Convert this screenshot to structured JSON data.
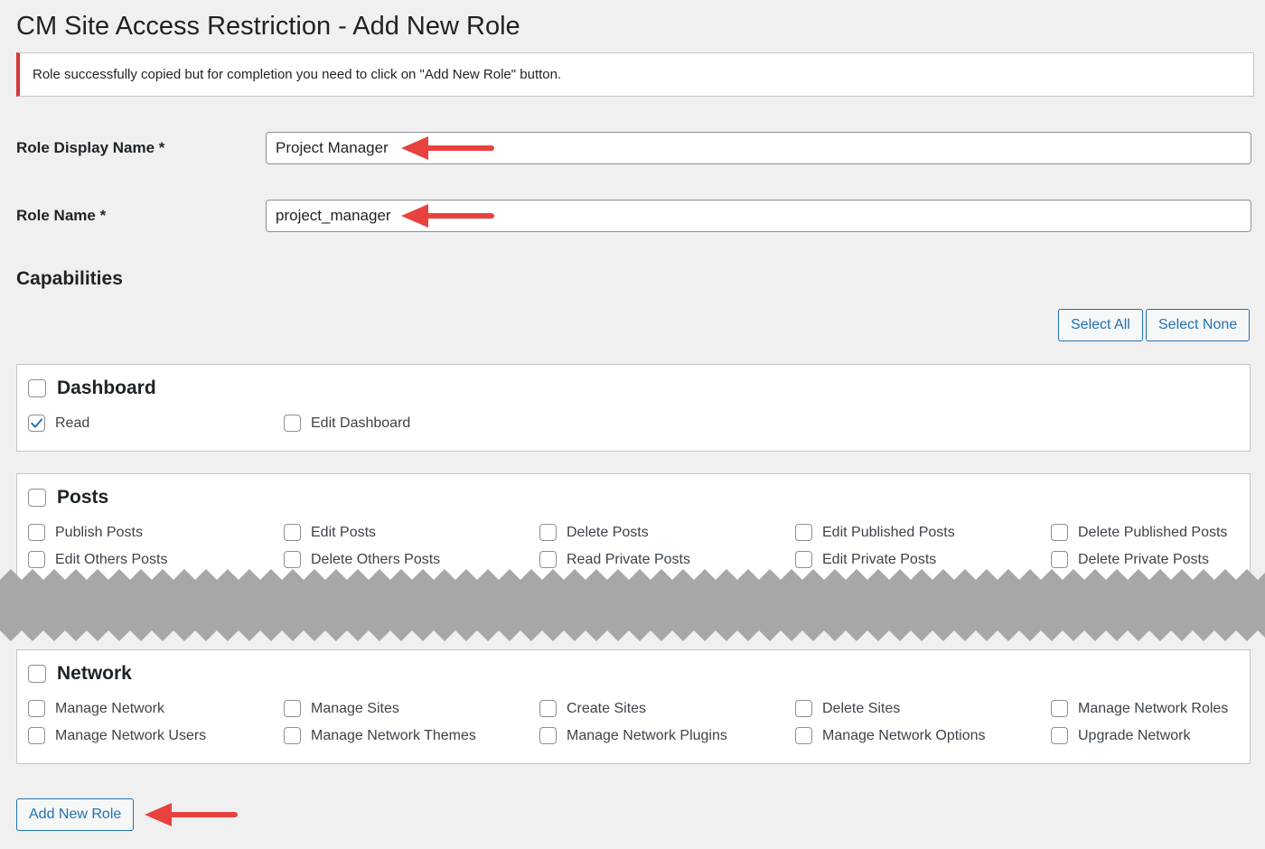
{
  "page_title": "CM Site Access Restriction - Add New Role",
  "notice_text": "Role successfully copied but for completion you need to click on \"Add New Role\" button.",
  "form": {
    "display_name_label": "Role Display Name *",
    "display_name_value": "Project Manager",
    "role_name_label": "Role Name *",
    "role_name_value": "project_manager"
  },
  "capabilities_title": "Capabilities",
  "select_all_label": "Select All",
  "select_none_label": "Select None",
  "groups": {
    "dashboard": {
      "title": "Dashboard",
      "checked": false,
      "items": [
        {
          "label": "Read",
          "checked": true
        },
        {
          "label": "Edit Dashboard",
          "checked": false
        }
      ]
    },
    "posts": {
      "title": "Posts",
      "checked": false,
      "items": [
        {
          "label": "Publish Posts",
          "checked": false
        },
        {
          "label": "Edit Posts",
          "checked": false
        },
        {
          "label": "Delete Posts",
          "checked": false
        },
        {
          "label": "Edit Published Posts",
          "checked": false
        },
        {
          "label": "Delete Published Posts",
          "checked": false
        },
        {
          "label": "Edit Others Posts",
          "checked": false
        },
        {
          "label": "Delete Others Posts",
          "checked": false
        },
        {
          "label": "Read Private Posts",
          "checked": false
        },
        {
          "label": "Edit Private Posts",
          "checked": false
        },
        {
          "label": "Delete Private Posts",
          "checked": false
        }
      ]
    },
    "network": {
      "title": "Network",
      "checked": false,
      "items": [
        {
          "label": "Manage Network",
          "checked": false
        },
        {
          "label": "Manage Sites",
          "checked": false
        },
        {
          "label": "Create Sites",
          "checked": false
        },
        {
          "label": "Delete Sites",
          "checked": false
        },
        {
          "label": "Manage Network Roles",
          "checked": false
        },
        {
          "label": "Manage Network Users",
          "checked": false
        },
        {
          "label": "Manage Network Themes",
          "checked": false
        },
        {
          "label": "Manage Network Plugins",
          "checked": false
        },
        {
          "label": "Manage Network Options",
          "checked": false
        },
        {
          "label": "Upgrade Network",
          "checked": false
        }
      ]
    }
  },
  "submit_label": "Add New Role",
  "colors": {
    "accent": "#2271b1",
    "notice_error": "#d63638",
    "annotation_arrow": "#e8423f",
    "tear_gray": "#a7a7a7"
  },
  "icons": {
    "checkmark": "check-icon",
    "annotation": "arrow-left-icon"
  }
}
